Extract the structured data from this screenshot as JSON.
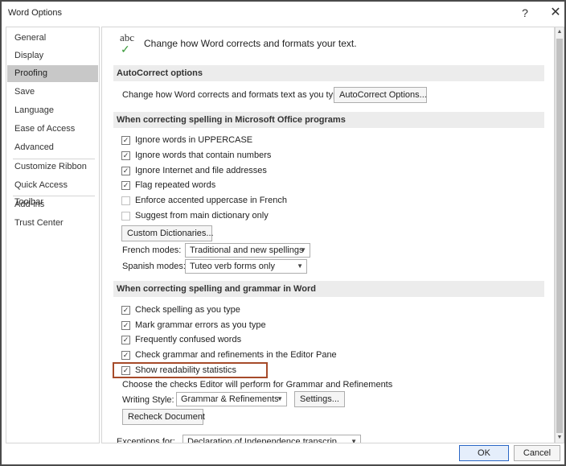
{
  "window": {
    "title": "Word Options",
    "help_glyph": "?",
    "close_glyph": "✕"
  },
  "sidebar": {
    "items": [
      {
        "label": "General"
      },
      {
        "label": "Display"
      },
      {
        "label": "Proofing",
        "selected": true
      },
      {
        "label": "Save"
      },
      {
        "label": "Language"
      },
      {
        "label": "Ease of Access"
      },
      {
        "label": "Advanced"
      },
      {
        "label": "Customize Ribbon"
      },
      {
        "label": "Quick Access Toolbar"
      },
      {
        "label": "Add-ins"
      },
      {
        "label": "Trust Center"
      }
    ]
  },
  "header": {
    "icon_text": "abc",
    "icon_check": "✓",
    "text": "Change how Word corrects and formats your text."
  },
  "autocorrect": {
    "section_title": "AutoCorrect options",
    "description": "Change how Word corrects and formats text as you type:",
    "button_label": "AutoCorrect Options..."
  },
  "office_spelling": {
    "section_title": "When correcting spelling in Microsoft Office programs",
    "options": [
      {
        "label": "Ignore words in UPPERCASE",
        "checked": true
      },
      {
        "label": "Ignore words that contain numbers",
        "checked": true
      },
      {
        "label": "Ignore Internet and file addresses",
        "checked": true
      },
      {
        "label": "Flag repeated words",
        "checked": true
      },
      {
        "label": "Enforce accented uppercase in French",
        "checked": false
      },
      {
        "label": "Suggest from main dictionary only",
        "checked": false
      }
    ],
    "custom_dictionaries_label": "Custom Dictionaries...",
    "french_modes_label": "French modes:",
    "french_modes_value": "Traditional and new spellings",
    "spanish_modes_label": "Spanish modes:",
    "spanish_modes_value": "Tuteo verb forms only"
  },
  "word_spelling": {
    "section_title": "When correcting spelling and grammar in Word",
    "options": [
      {
        "label": "Check spelling as you type",
        "checked": true
      },
      {
        "label": "Mark grammar errors as you type",
        "checked": true
      },
      {
        "label": "Frequently confused words",
        "checked": true
      },
      {
        "label": "Check grammar and refinements in the Editor Pane",
        "checked": true
      },
      {
        "label": "Show readability statistics",
        "checked": true
      }
    ],
    "editor_note": "Choose the checks Editor will perform for Grammar and Refinements",
    "writing_style_label": "Writing Style:",
    "writing_style_value": "Grammar & Refinements",
    "settings_label": "Settings...",
    "recheck_label": "Recheck Document"
  },
  "exceptions": {
    "label": "Exceptions for:",
    "value": "Declaration of Independence transcrip"
  },
  "footer": {
    "ok_label": "OK",
    "cancel_label": "Cancel"
  },
  "colors": {
    "highlight_border": "#a64b2a",
    "selected_nav": "#c8c8c8",
    "checkmark_green": "#3a9a3a",
    "ok_border": "#2b67c5"
  },
  "check_glyph": "✓",
  "dropdown_arrow": "▼"
}
